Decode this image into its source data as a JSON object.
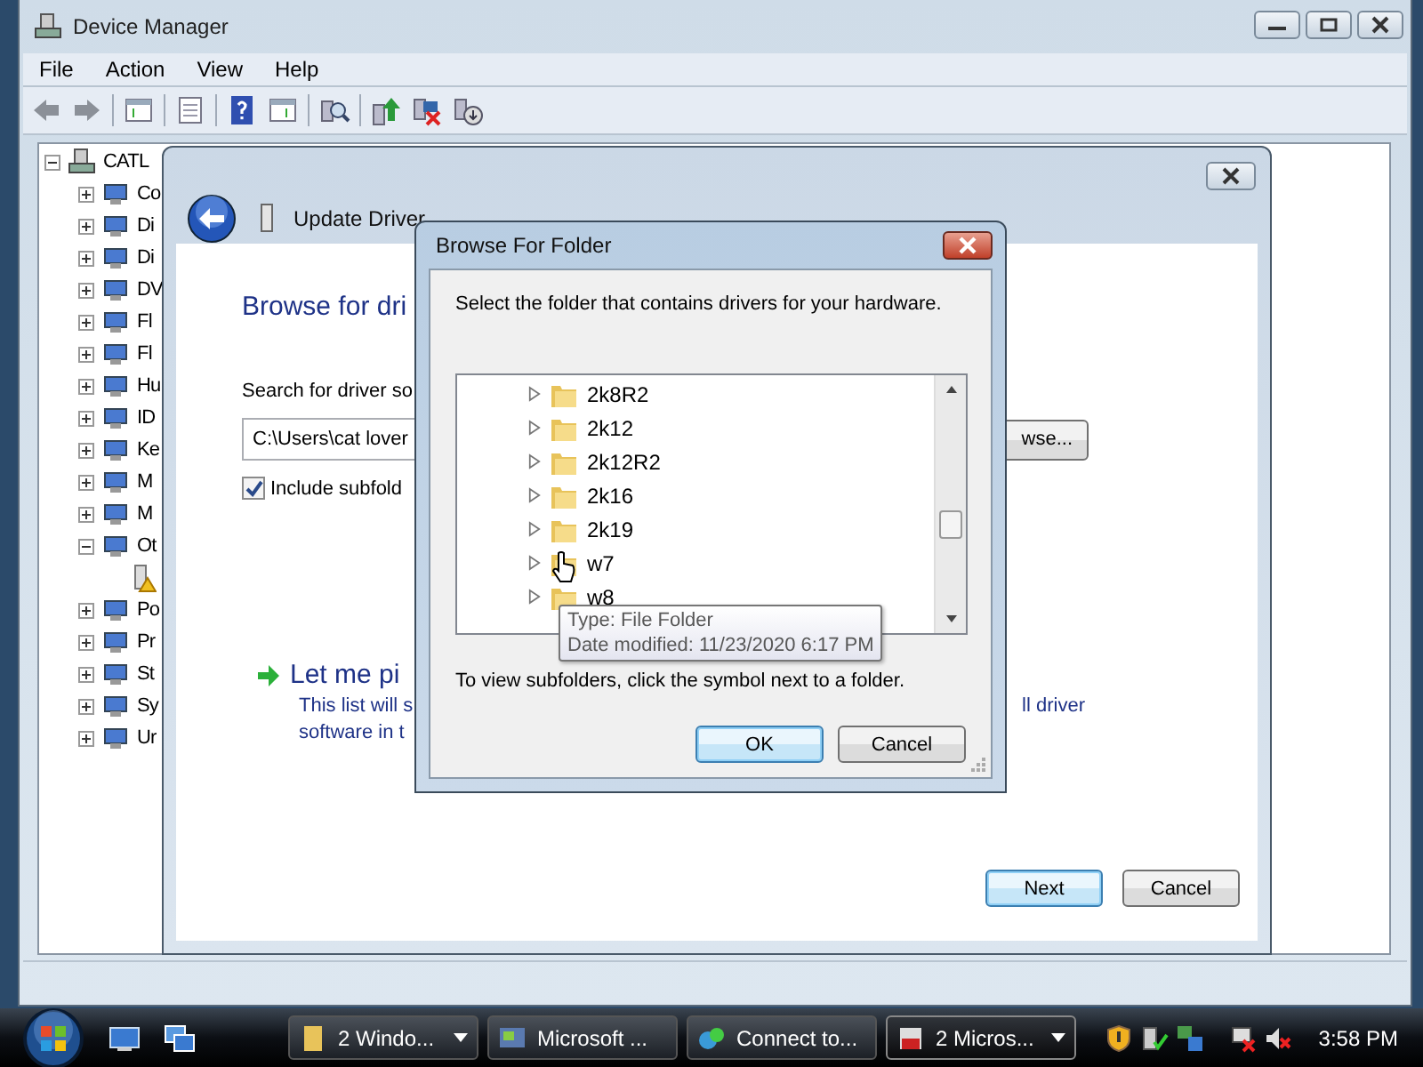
{
  "device_manager": {
    "title": "Device Manager",
    "menu": [
      "File",
      "Action",
      "View",
      "Help"
    ],
    "tree": {
      "label": "CATL",
      "expanded": true,
      "children": [
        {
          "label": "Co",
          "expanded": false
        },
        {
          "label": "Di",
          "expanded": false
        },
        {
          "label": "Di",
          "expanded": false
        },
        {
          "label": "DV",
          "expanded": false
        },
        {
          "label": "Fl",
          "expanded": false
        },
        {
          "label": "Fl",
          "expanded": false
        },
        {
          "label": "Hu",
          "expanded": false
        },
        {
          "label": "ID",
          "expanded": false
        },
        {
          "label": "Ke",
          "expanded": false
        },
        {
          "label": "M",
          "expanded": false
        },
        {
          "label": "M",
          "expanded": false
        },
        {
          "label": "Ot",
          "expanded": true,
          "children": [
            {
              "kind": "warning-device"
            }
          ]
        },
        {
          "label": "Po",
          "expanded": false
        },
        {
          "label": "Pr",
          "expanded": false
        },
        {
          "label": "St",
          "expanded": false
        },
        {
          "label": "Sy",
          "expanded": false
        },
        {
          "label": "Ur",
          "expanded": false
        }
      ]
    }
  },
  "wizard": {
    "title": "Update Driver",
    "heading": "Browse for dri",
    "search_label": "Search for driver so",
    "path_value": "C:\\Users\\cat lover",
    "browse_button": "wse...",
    "include_subfolders": {
      "label": "Include subfold",
      "checked": true
    },
    "let_me_pick": {
      "title": "Let me pi",
      "line_1": "This list will s",
      "line_1_right": "ll driver",
      "line_2": "software in t"
    },
    "buttons": [
      {
        "label": "Next",
        "default": true
      },
      {
        "label": "Cancel",
        "default": false
      }
    ]
  },
  "browse_dialog": {
    "title": "Browse For Folder",
    "instruction": "Select the folder that contains drivers for your hardware.",
    "folders": [
      {
        "label": "2k8R2"
      },
      {
        "label": "2k12"
      },
      {
        "label": "2k12R2"
      },
      {
        "label": "2k16"
      },
      {
        "label": "2k19"
      },
      {
        "label": "w7"
      },
      {
        "label": "w8"
      }
    ],
    "tooltip": [
      "Type: File Folder",
      "Date modified: 11/23/2020 6:17 PM"
    ],
    "hint": "To view subfolders, click the symbol next to a folder.",
    "buttons": [
      {
        "label": "OK",
        "default": true
      },
      {
        "label": "Cancel",
        "default": false
      }
    ]
  },
  "taskbar": {
    "tasks": [
      {
        "label": "2 Windo...",
        "selected": false,
        "grouped": true
      },
      {
        "label": "Microsoft ...",
        "selected": false,
        "grouped": false
      },
      {
        "label": "Connect to...",
        "selected": false,
        "grouped": false
      },
      {
        "label": "2 Micros...",
        "selected": true,
        "grouped": true
      }
    ],
    "clock": "3:58 PM"
  }
}
